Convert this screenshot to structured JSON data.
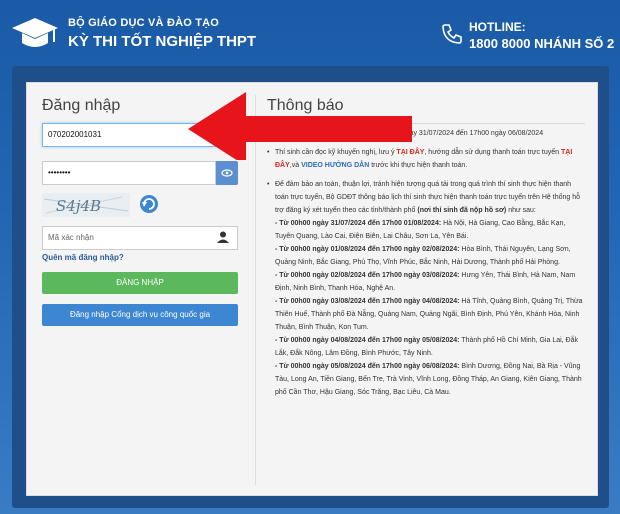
{
  "header": {
    "org_name": "BỘ GIÁO DỤC VÀ ĐÀO TẠO",
    "exam_name": "KỲ THI TỐT NGHIỆP THPT",
    "hotline_label": "HOTLINE:",
    "hotline_number": "1800 8000 NHÁNH SỐ 2"
  },
  "login": {
    "title": "Đăng nhập",
    "username_value": "070202001031",
    "password_value": "••••••••",
    "captcha_text": "S4j4B",
    "captcha_placeholder": "Mã xác nhận",
    "forgot_label": "Quên mã đăng nhập?",
    "submit_label": "ĐĂNG NHẬP",
    "portal_label": "Đăng nhập Cổng dịch vụ công quốc gia"
  },
  "notice": {
    "title": "Thông báo",
    "item1_a": "Hệ thống mở phí xét tuyển trực tuyến từ ngày 31/07/2024 đến 17h00 ngày 06/08/2024",
    "item2_a": "Thí sinh cần đọc kỹ khuyến nghị, lưu ý ",
    "item2_link1": "TẠI ĐÂY",
    "item2_b": ", hướng dẫn sử dụng thanh toán trực tuyến ",
    "item2_link2": "TẠI ĐÂY",
    "item2_c": ",và ",
    "item2_link3": "VIDEO HƯỚNG DẪN",
    "item2_d": " trước khi thực hiện thanh toán.",
    "item3_a": "Để đảm bảo an toàn, thuận lợi, tránh hiện tượng quá tải trong quá trình thí sinh thực hiện thanh toán trực tuyến, Bộ GDĐT thông báo lịch thí sinh thực hiện thanh toán trực tuyến trên Hệ thống hỗ trợ đăng ký xét tuyển theo các tỉnh/thành phố ",
    "item3_bold": "(nơi thí sinh đã nộp hồ sơ)",
    "item3_b": " như sau:",
    "schedule": [
      {
        "when": "- Từ 00h00 ngày 31/07/2024 đến 17h00 01/08/2024:",
        "where": " Hà Nội, Hà Giang, Cao Bằng, Bắc Kạn, Tuyên Quang, Lào Cai, Điện Biên, Lai Châu, Sơn La, Yên Bái."
      },
      {
        "when": "- Từ 00h00 ngày 01/08/2024 đến 17h00 ngày 02/08/2024:",
        "where": " Hòa Bình, Thái Nguyên, Lạng Sơn, Quảng Ninh, Bắc Giang, Phú Thọ, Vĩnh Phúc, Bắc Ninh, Hải Dương, Thành phố Hải Phòng."
      },
      {
        "when": "- Từ 00h00 ngày 02/08/2024 đến 17h00 ngày 03/08/2024:",
        "where": " Hưng Yên, Thái Bình, Hà Nam, Nam Định, Ninh Bình, Thanh Hóa, Nghệ An."
      },
      {
        "when": "- Từ 00h00 ngày 03/08/2024 đến 17h00 ngày 04/08/2024:",
        "where": " Hà Tĩnh, Quảng Bình, Quảng Trị, Thừa Thiên Huế, Thành phố Đà Nẵng, Quảng Nam, Quảng Ngãi, Bình Định, Phú Yên, Khánh Hòa, Ninh Thuận, Bình Thuận, Kon Tum."
      },
      {
        "when": "- Từ 00h00 ngày 04/08/2024 đến 17h00 ngày 05/08/2024:",
        "where": " Thành phố Hồ Chí Minh, Gia Lai, Đắk Lắk, Đắk Nông, Lâm Đồng, Bình Phước, Tây Ninh."
      },
      {
        "when": "- Từ 00h00 ngày 05/08/2024 đến 17h00 ngày 06/08/2024:",
        "where": " Bình Dương, Đồng Nai, Bà Rịa - Vũng Tàu, Long An, Tiền Giang, Bến Tre, Trà Vinh, Vĩnh Long, Đồng Tháp, An Giang, Kiên Giang, Thành phố Cần Thơ, Hậu Giang, Sóc Trăng, Bạc Liêu, Cà Mau."
      }
    ]
  },
  "colors": {
    "arrow": "#e8141b",
    "header_bg": "#1a5aa6",
    "green": "#5cb85c",
    "blue": "#3d86d1"
  },
  "icons": {
    "logo": "graduation-cap-icon",
    "phone": "phone-icon",
    "eye": "eye-icon",
    "refresh": "refresh-icon",
    "user": "user-icon"
  }
}
